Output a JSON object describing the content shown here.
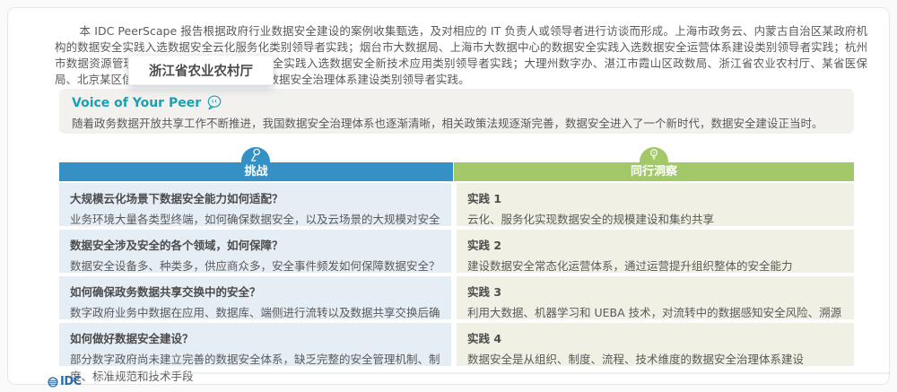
{
  "intro": {
    "text": "本 IDC PeerScape 报告根据政府行业数据安全建设的案例收集甄选，及对相应的 IT 负责人或领导者进行访谈而形成。上海市政务云、内蒙古自治区某政府机构的数据安全实践入选数据安全云化服务化类别领导者实践；烟台市大数据局、上海市大数据中心的数据安全实践入选数据安全运营体系建设类别领导者实践；杭州市数据资源管理局、烟台大数据局的数据安全实践入选数据安全新技术应用类别领导者实践；大理州数字办、湛江市霞山区政数局、浙江省农业农村厅、某省医保局、北京某区信息中心的数据安全实践入选数据安全治理体系建设类别领导者实践。"
  },
  "tooltip": {
    "text": "浙江省农业农村厅"
  },
  "voice": {
    "title": "Voice of Your Peer",
    "body": "随着政务数据开放共享工作不断推进，我国数据安全治理体系也逐渐清晰，相关政策法规逐渐完善，数据安全进入了一个新时代，数据安全建设正当时。"
  },
  "table": {
    "challenge_header": "挑战",
    "insight_header": "同行洞察",
    "rows": [
      {
        "challenge_title": "大规模云化场景下数据安全能力如何适配？",
        "challenge_body": "业务环境大量各类型终端，如何确保数据安全，以及云场景的大规模对安全产品和方案提出挑战",
        "insight_title": "实践 1",
        "insight_body": "云化、服务化实现数据安全的规模建设和集约共享"
      },
      {
        "challenge_title": "数据安全涉及安全的各个领域，如何保障？",
        "challenge_body": "数据安全设备多、种类多，供应商众多，安全事件频发如何保障数据安全？",
        "insight_title": "实践 2",
        "insight_body": "建设数据安全常态化运营体系，通过运营提升组织整体的安全能力"
      },
      {
        "challenge_title": "如何确保政务数据共享交换中的安全？",
        "challenge_body": "数字政府业务中数据在应用、数据库、端侧进行流转以及数据共享交换后确保数据安全",
        "insight_title": "实践 3",
        "insight_body": "利用大数据、机器学习和 UEBA 技术，对流转中的数据感知安全风险、溯源防护"
      },
      {
        "challenge_title": "如何做好数据安全建设？",
        "challenge_body": "部分数字政府尚未建立完善的数据安全体系，缺乏完整的安全管理机制、制度、标准规范和技术手段",
        "insight_title": "实践 4",
        "insight_body": "数据安全是从组织、制度、流程、技术维度的数据安全治理体系建设"
      }
    ]
  },
  "footer": {
    "logo_text": "IDC"
  },
  "icons": {
    "voice_icon": "speech-bubble-icon",
    "challenge_icon": "flag-icon",
    "insight_icon": "lightbulb-icon",
    "logo_icon": "globe-icon"
  },
  "colors": {
    "challenge_header_bg": "#3591c5",
    "insight_header_bg": "#a3c869",
    "challenge_cell_bg": "#e6eef5",
    "insight_cell_bg": "#f0f0e5",
    "voice_accent": "#17a2b2",
    "logo_blue": "#2e6ba6"
  }
}
